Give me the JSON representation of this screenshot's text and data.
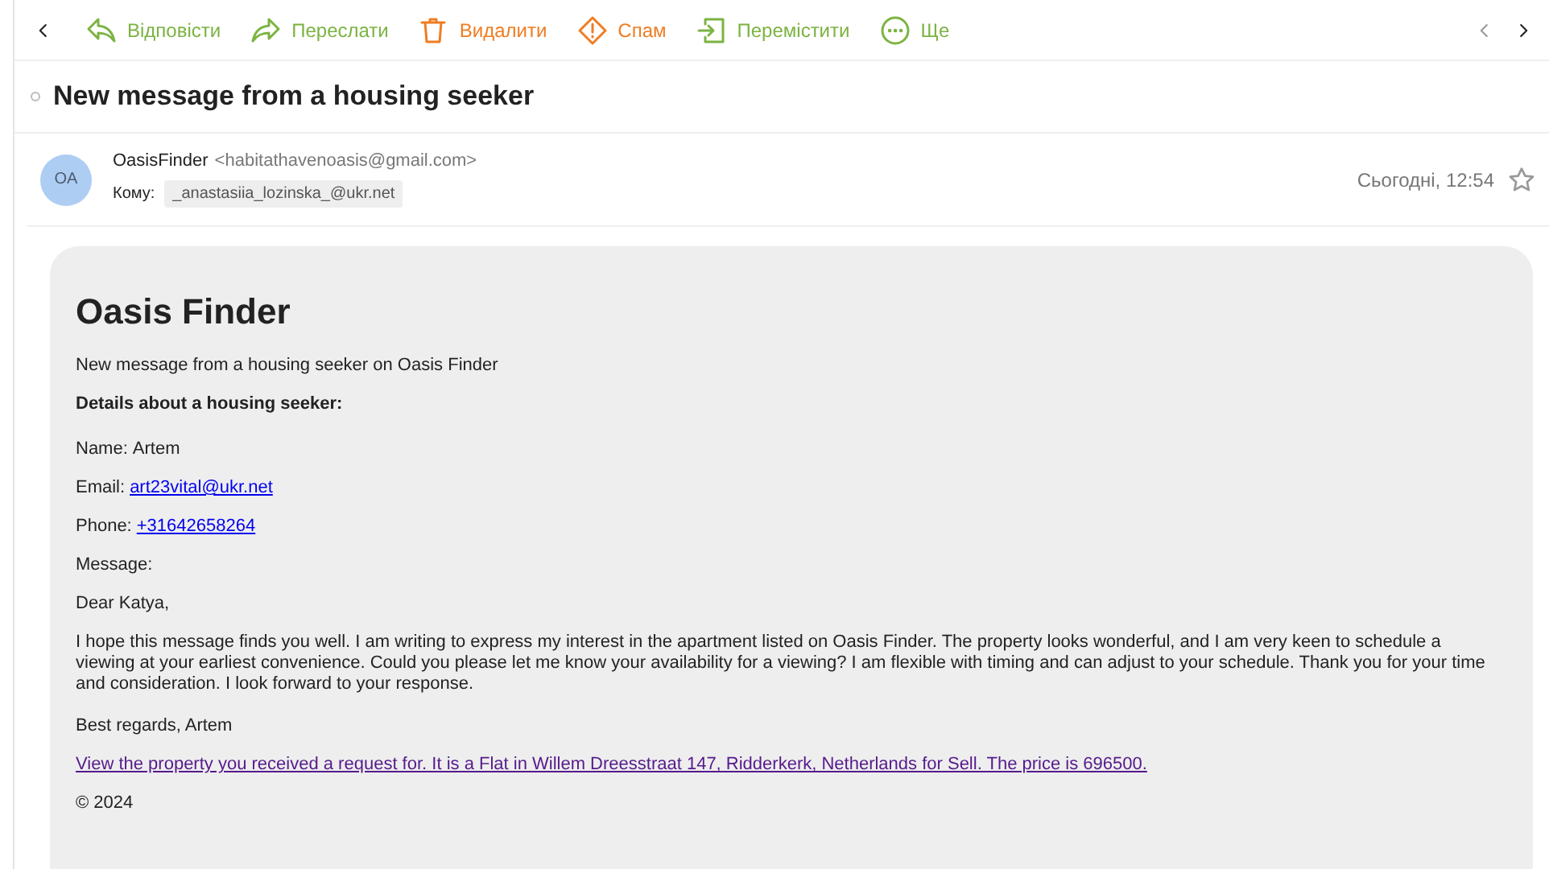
{
  "toolbar": {
    "actions": [
      {
        "kind": "reply",
        "label": "Відповісти",
        "color": "#7cb342"
      },
      {
        "kind": "forward",
        "label": "Переслати",
        "color": "#7cb342"
      },
      {
        "kind": "delete",
        "label": "Видалити",
        "color": "#ef7d22"
      },
      {
        "kind": "spam",
        "label": "Спам",
        "color": "#ef7d22"
      },
      {
        "kind": "move",
        "label": "Перемістити",
        "color": "#7cb342"
      },
      {
        "kind": "more",
        "label": "Ще",
        "color": "#7cb342"
      }
    ]
  },
  "subject": "New message from a housing seeker",
  "header": {
    "avatar": "OA",
    "sender_name": "OasisFinder",
    "sender_email": "<habitathavenoasis@gmail.com>",
    "to_label": "Кому:",
    "to": "_anastasiia_lozinska_@ukr.net",
    "date": "Сьогодні, 12:54",
    "starred": false
  },
  "body": {
    "brand": "Oasis Finder",
    "intro": "New message from a housing seeker on Oasis Finder",
    "details_heading": "Details about a housing seeker:",
    "fields": [
      {
        "kind": "text",
        "label": "Name:",
        "value": "Artem"
      },
      {
        "kind": "link",
        "label": "Email:",
        "value": "art23vital@ukr.net"
      },
      {
        "kind": "link",
        "label": "Phone:",
        "value": "+31642658264"
      }
    ],
    "message_label": "Message:",
    "greeting": "Dear Katya,",
    "message": "I hope this message finds you well. I am writing to express my interest in the apartment listed on Oasis Finder. The property looks wonderful, and I am very keen to schedule a viewing at your earliest convenience. Could you please let me know your availability for a viewing? I am flexible with timing and can adjust to your schedule. Thank you for your time and consideration. I look forward to your response.",
    "signoff": "Best regards, Artem",
    "property_link": "View the property you received a request for. It is a Flat in Willem Dreesstraat 147, Ridderkerk, Netherlands for Sell. The price is 696500.",
    "copyright": "© 2024"
  }
}
